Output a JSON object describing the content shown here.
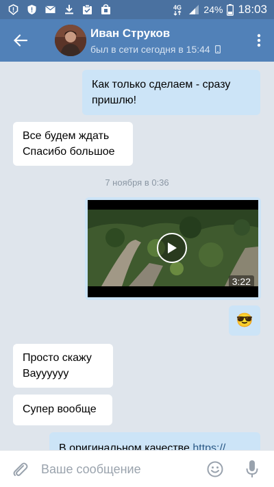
{
  "statusbar": {
    "network": "4G",
    "battery": "24%",
    "time": "18:03",
    "icons": [
      "alert-icon",
      "shield-icon",
      "mail-icon",
      "download-icon",
      "clipboard-icon",
      "bag-icon"
    ]
  },
  "header": {
    "name": "Иван Струков",
    "status": "был в сети сегодня в 15:44"
  },
  "messages": [
    {
      "id": "m1",
      "direction": "out",
      "lines": [
        "Как только сделаем - сразу",
        "пришлю!"
      ]
    },
    {
      "id": "m2",
      "direction": "in",
      "lines": [
        "Все будем ждать",
        "Спасибо большое"
      ]
    },
    {
      "id": "sep1",
      "type": "date",
      "text": "7 ноября в 0:36"
    },
    {
      "id": "m3",
      "direction": "out",
      "type": "video",
      "duration": "3:22"
    },
    {
      "id": "m4",
      "direction": "out",
      "type": "emoji",
      "text": "😎"
    },
    {
      "id": "m5",
      "direction": "in",
      "lines": [
        "Просто скажу",
        "Вауууууу"
      ]
    },
    {
      "id": "m6",
      "direction": "in",
      "lines": [
        "Супер вообще"
      ]
    },
    {
      "id": "m7",
      "direction": "out",
      "text": "В оригинальном качестве",
      "link": "https://"
    }
  ],
  "composer": {
    "placeholder": "Ваше сообщение"
  },
  "colors": {
    "header": "#5181b8",
    "statusbar": "#4a71a0",
    "chat_bg": "#dfe5ec",
    "outgoing": "#cce4f7",
    "incoming": "#ffffff",
    "link": "#2a5885"
  }
}
